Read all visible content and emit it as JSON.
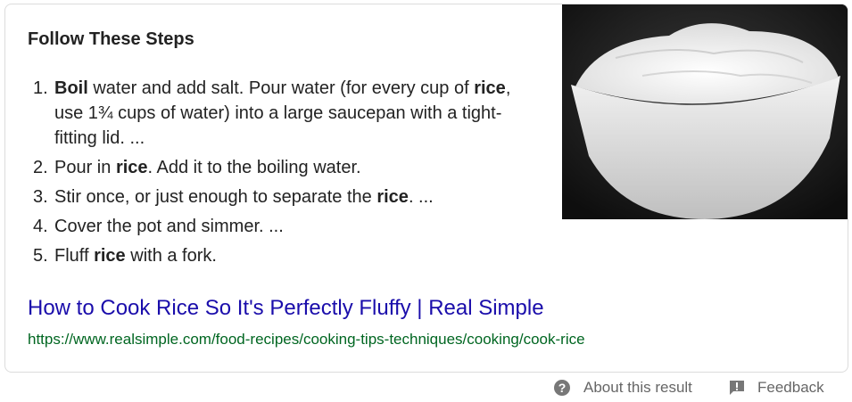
{
  "snippet": {
    "heading": "Follow These Steps",
    "steps": [
      {
        "num": "1.",
        "parts": [
          {
            "text": "Boil",
            "bold": true
          },
          {
            "text": " water and add salt. Pour water (for every cup of ",
            "bold": false
          },
          {
            "text": "rice",
            "bold": true
          },
          {
            "text": ", use 1¾ cups of water) into a large saucepan with a tight-fitting lid. ...",
            "bold": false
          }
        ]
      },
      {
        "num": "2.",
        "parts": [
          {
            "text": "Pour in ",
            "bold": false
          },
          {
            "text": "rice",
            "bold": true
          },
          {
            "text": ". Add it to the boiling water.",
            "bold": false
          }
        ]
      },
      {
        "num": "3.",
        "parts": [
          {
            "text": "Stir once, or just enough to separate the ",
            "bold": false
          },
          {
            "text": "rice",
            "bold": true
          },
          {
            "text": ". ...",
            "bold": false
          }
        ]
      },
      {
        "num": "4.",
        "parts": [
          {
            "text": "Cover the pot and simmer. ...",
            "bold": false
          }
        ]
      },
      {
        "num": "5.",
        "parts": [
          {
            "text": "Fluff ",
            "bold": false
          },
          {
            "text": "rice",
            "bold": true
          },
          {
            "text": " with a fork.",
            "bold": false
          }
        ]
      }
    ],
    "image": {
      "icon": "rice-bowl-photo"
    },
    "result": {
      "title": "How to Cook Rice So It's Perfectly Fluffy | Real Simple",
      "url": "https://www.realsimple.com/food-recipes/cooking-tips-techniques/cooking/cook-rice"
    }
  },
  "footer": {
    "about_label": "About this result",
    "about_icon": "help-circle-icon",
    "feedback_label": "Feedback",
    "feedback_icon": "feedback-icon"
  },
  "colors": {
    "link": "#1a0dab",
    "url": "#006621",
    "muted": "#666666"
  }
}
